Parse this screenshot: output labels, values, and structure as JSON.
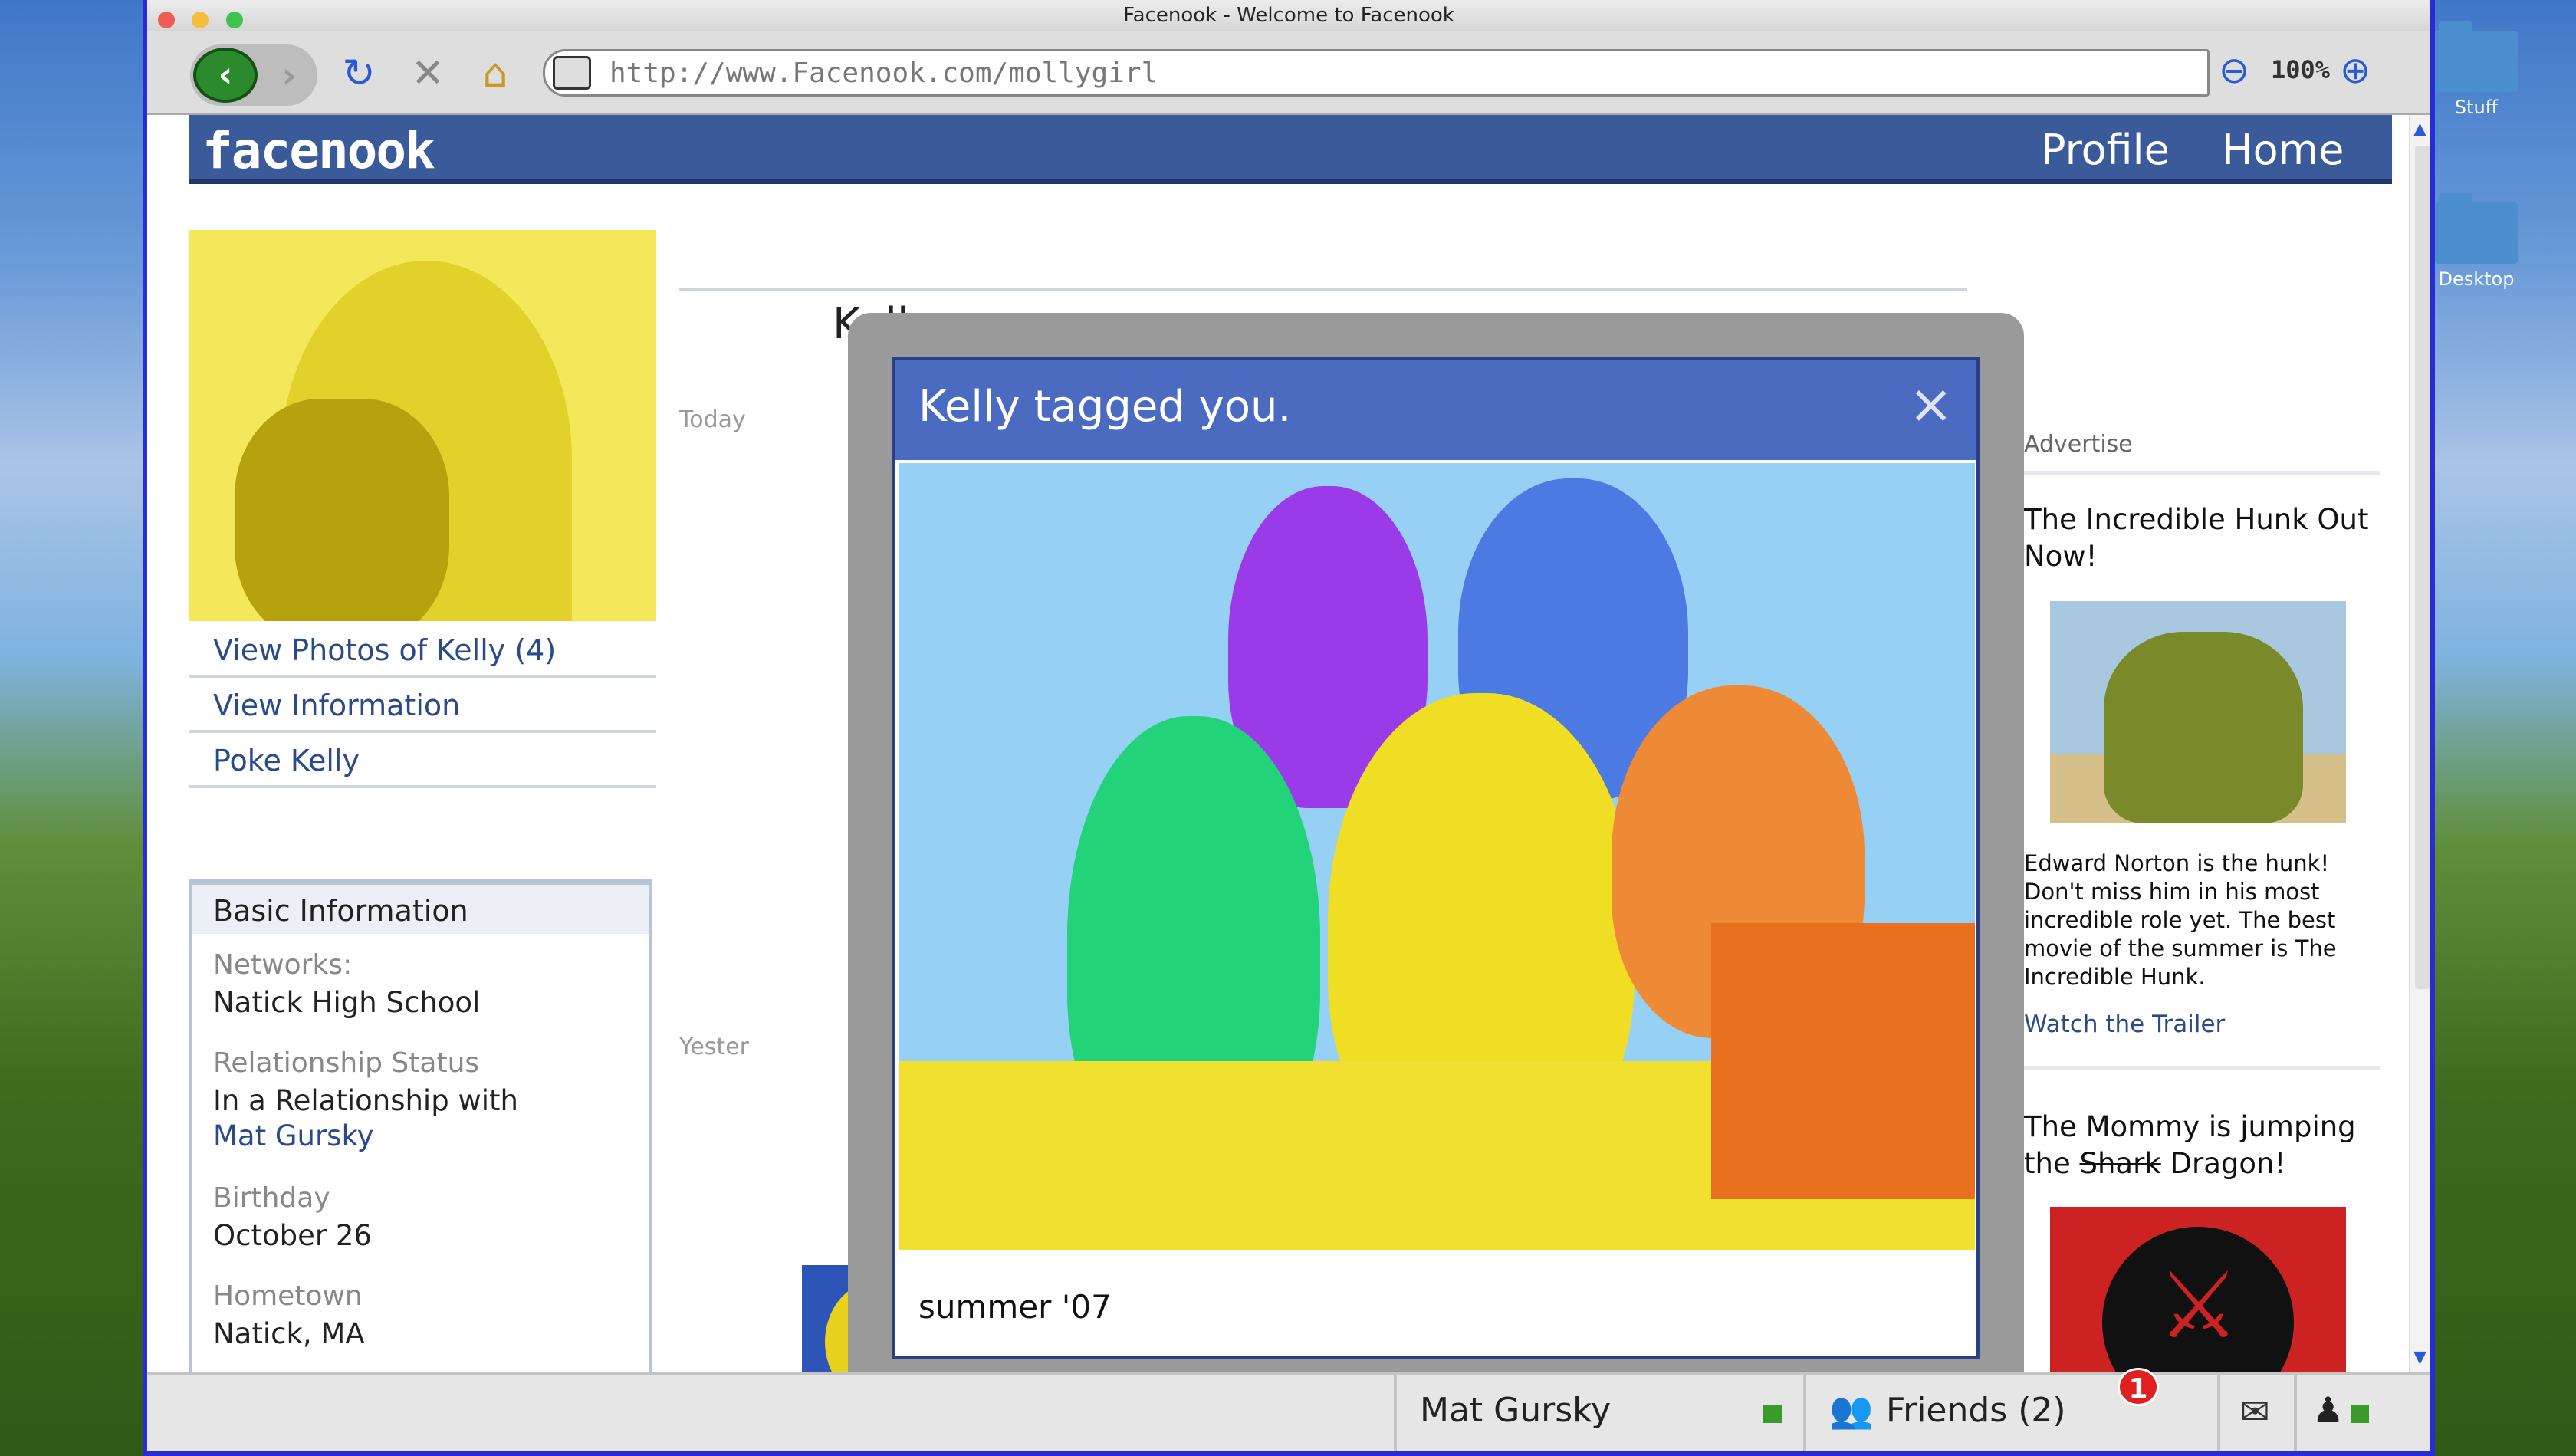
{
  "window": {
    "title": "Facenook - Welcome to Facenook"
  },
  "desktop": {
    "icons": [
      {
        "label": "Stuff",
        "icon": "folder-icon"
      },
      {
        "label": "Desktop",
        "icon": "folder-icon"
      }
    ]
  },
  "toolbar": {
    "url": "http://www.Facenook.com/mollygirl",
    "zoom": "100%",
    "icons": [
      "back-icon",
      "forward-icon",
      "reload-icon",
      "stop-icon",
      "home-icon",
      "site-identity-icon",
      "zoom-out-icon",
      "zoom-in-icon"
    ]
  },
  "site": {
    "logo": "facenook",
    "nav": {
      "profile": "Profile",
      "home": "Home"
    }
  },
  "profile": {
    "name_partial": "Kell",
    "links": [
      "View Photos of Kelly (4)",
      "View Information",
      "Poke Kelly"
    ],
    "basic": {
      "title": "Basic Information",
      "networks_label": "Networks:",
      "networks": "Natick High School",
      "relationship_label": "Relationship Status",
      "relationship": "In a Relationship with",
      "partner": "Mat Gursky",
      "birthday_label": "Birthday",
      "birthday": "October 26",
      "hometown_label": "Hometown",
      "hometown": "Natick, MA"
    }
  },
  "feed": {
    "today": "Today",
    "yesterday": "Yester"
  },
  "ads": {
    "header": "Advertise",
    "ad1": {
      "title": "The Incredible Hunk Out Now!",
      "desc": "Edward Norton is the hunk! Don't miss him in his most incredible role yet. The best movie of the summer is The Incredible Hunk.",
      "link": "Watch the Trailer"
    },
    "ad2": {
      "title_pre": "The Mommy is jumping the ",
      "title_strike": "Shark",
      "title_post": " Dragon!"
    }
  },
  "modal": {
    "title": "Kelly tagged you.",
    "caption": "summer '07",
    "close": "×"
  },
  "statusbar": {
    "user": "Mat Gursky",
    "friends": "Friends (2)",
    "notifications": "1"
  },
  "colors": {
    "fb_blue": "#3b5a9a",
    "modal_header": "#4b6bc0",
    "link": "#2a4a8a",
    "online": "#3a9a2a",
    "badge": "#e02020"
  }
}
